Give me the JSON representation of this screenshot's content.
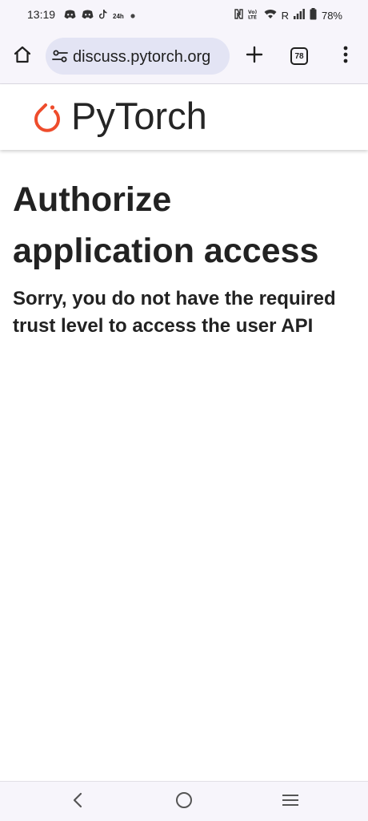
{
  "status_bar": {
    "time": "13:19",
    "small_icon_text": "24h",
    "volte_text": "Vo)\nLTE",
    "roaming_text": "R",
    "battery": "78%",
    "notification_icons": [
      "discord-icon",
      "discord-icon",
      "tiktok-icon",
      "24h-icon",
      "dot-icon"
    ],
    "system_icons": [
      "nfc-icon",
      "volte-icon",
      "wifi-icon",
      "roaming-icon",
      "signal-icon",
      "battery-icon"
    ]
  },
  "browser": {
    "url": "discuss.pytorch.org",
    "tab_count": "78",
    "icons": {
      "home": "home-icon",
      "site_settings": "tune-icon",
      "new_tab": "plus-icon",
      "tabs": "tab-switcher-icon",
      "menu": "more-vert-icon"
    }
  },
  "site": {
    "logo_text": "PyTorch",
    "brand_color": "#ee4c2c"
  },
  "main": {
    "title": "Authorize application access",
    "message": "Sorry, you do not have the required trust level to access the user API"
  },
  "nav_bar": {
    "icons": [
      "back-icon",
      "home-circle-icon",
      "recents-icon"
    ]
  }
}
